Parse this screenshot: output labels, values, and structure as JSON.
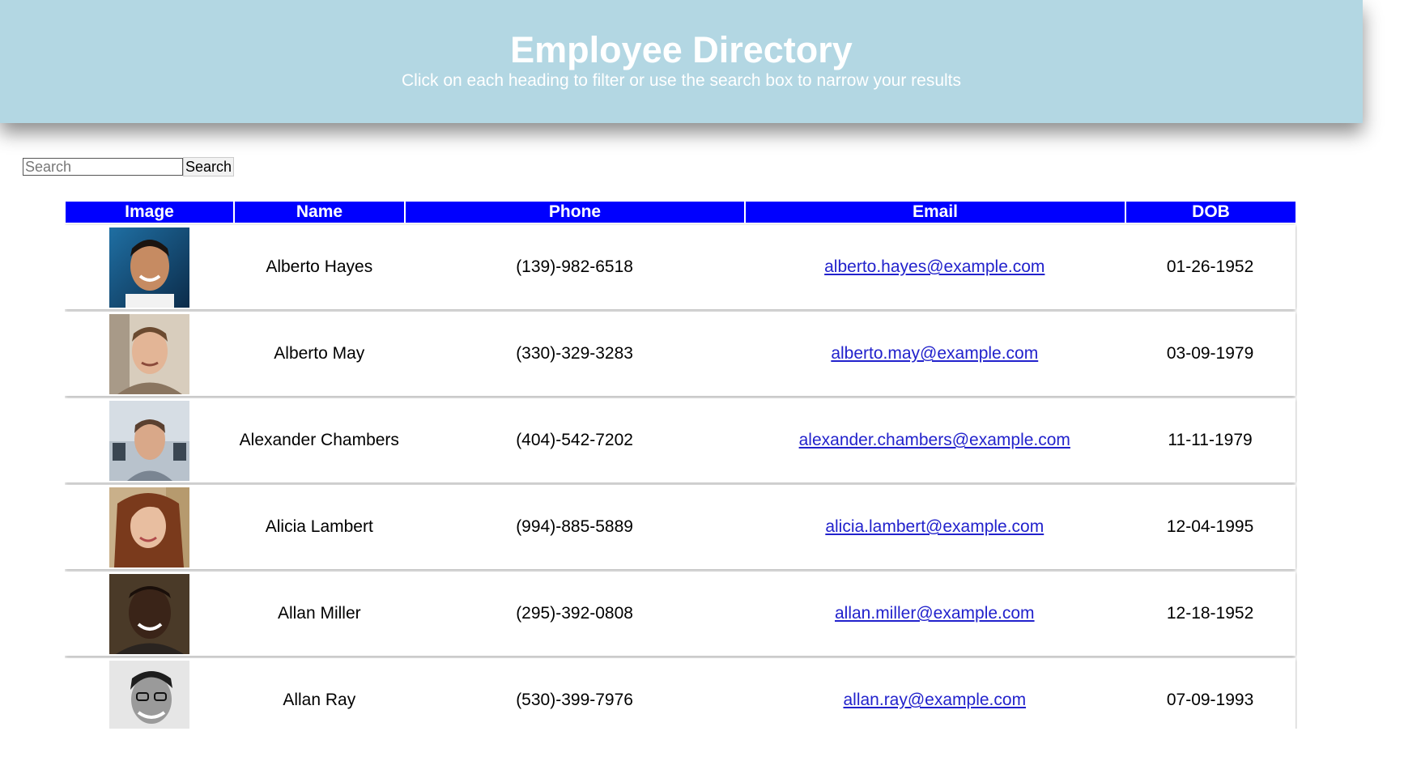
{
  "header": {
    "title": "Employee Directory",
    "subtitle": "Click on each heading to filter or use the search box to narrow your results"
  },
  "search": {
    "placeholder": "Search",
    "button_label": "Search"
  },
  "table": {
    "headers": [
      "Image",
      "Name",
      "Phone",
      "Email",
      "DOB"
    ],
    "rows": [
      {
        "name": "Alberto Hayes",
        "phone": "(139)-982-6518",
        "email": "alberto.hayes@example.com",
        "dob": "01-26-1952"
      },
      {
        "name": "Alberto May",
        "phone": "(330)-329-3283",
        "email": "alberto.may@example.com",
        "dob": "03-09-1979"
      },
      {
        "name": "Alexander Chambers",
        "phone": "(404)-542-7202",
        "email": "alexander.chambers@example.com",
        "dob": "11-11-1979"
      },
      {
        "name": "Alicia Lambert",
        "phone": "(994)-885-5889",
        "email": "alicia.lambert@example.com",
        "dob": "12-04-1995"
      },
      {
        "name": "Allan Miller",
        "phone": "(295)-392-0808",
        "email": "allan.miller@example.com",
        "dob": "12-18-1952"
      },
      {
        "name": "Allan Ray",
        "phone": "(530)-399-7976",
        "email": "allan.ray@example.com",
        "dob": "07-09-1993"
      }
    ]
  },
  "colors": {
    "header_bg": "#b3d7e3",
    "table_header_bg": "#0000ff",
    "link": "#2222cc"
  }
}
